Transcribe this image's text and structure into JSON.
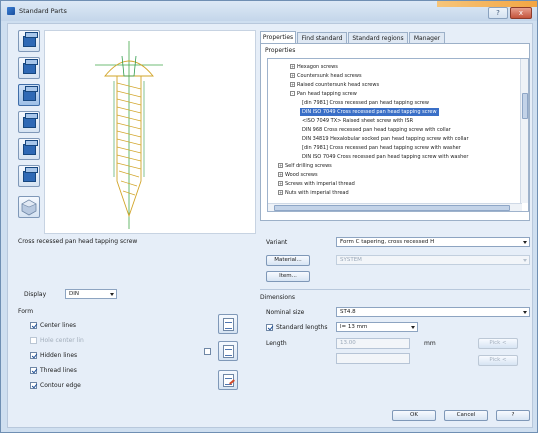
{
  "window": {
    "title": "Standard Parts",
    "help_glyph": "?",
    "close_glyph": "x"
  },
  "preview": {
    "caption": "Cross recessed pan head tapping screw"
  },
  "left": {
    "display_label": "Display",
    "display_value": "DIN",
    "form_label": "Form",
    "checkboxes": [
      {
        "label": "Center lines",
        "checked": true,
        "enabled": true
      },
      {
        "label": "Hole center lin",
        "checked": false,
        "enabled": false
      },
      {
        "label": "Hidden lines",
        "checked": true,
        "enabled": true
      },
      {
        "label": "Thread lines",
        "checked": true,
        "enabled": true
      },
      {
        "label": "Contour edge",
        "checked": true,
        "enabled": true
      }
    ]
  },
  "tabs": [
    "Properties",
    "Find standard",
    "Standard regions",
    "Manager"
  ],
  "properties": {
    "group_label": "Properties",
    "tree": [
      {
        "label": "Hexagon screws",
        "level": 2,
        "expander": "+",
        "selected": false
      },
      {
        "label": "Countersunk head screws",
        "level": 2,
        "expander": "+",
        "selected": false
      },
      {
        "label": "Raised countersunk head screws",
        "level": 2,
        "expander": "+",
        "selected": false
      },
      {
        "label": "Pan head tapping screw",
        "level": 2,
        "expander": "-",
        "selected": false
      },
      {
        "label": "[din 7981]  Cross recessed pan head tapping screw",
        "level": 3,
        "expander": "",
        "selected": false
      },
      {
        "label": "DIN ISO 7049  Cross recessed pan head tapping screw",
        "level": 3,
        "expander": "",
        "selected": true
      },
      {
        "label": "<ISO 7049 TX>  Raised sheet screw with ISR",
        "level": 3,
        "expander": "",
        "selected": false
      },
      {
        "label": "DIN 968  Cross recessed pan head tapping screw with collar",
        "level": 3,
        "expander": "",
        "selected": false
      },
      {
        "label": "DIN 34819  Hexalobular socked pan head tapping screw with collar",
        "level": 3,
        "expander": "",
        "selected": false
      },
      {
        "label": "[din 7981]  Cross recessed pan head tapping screw with washer",
        "level": 3,
        "expander": "",
        "selected": false
      },
      {
        "label": "DIN ISO 7049  Cross recessed pan head tapping screw with washer",
        "level": 3,
        "expander": "",
        "selected": false
      },
      {
        "label": "Self drilling screws",
        "level": 1,
        "expander": "+",
        "selected": false
      },
      {
        "label": "Wood screws",
        "level": 1,
        "expander": "+",
        "selected": false
      },
      {
        "label": "Screws with imperial thread",
        "level": 1,
        "expander": "+",
        "selected": false
      },
      {
        "label": "Nuts with imperial thread",
        "level": 1,
        "expander": "+",
        "selected": false
      }
    ],
    "variant_label": "Variant",
    "variant_value": "Form C tapering, cross recessed H",
    "material_button": "Material...",
    "material_value": "SYSTEM",
    "item_button": "Item..."
  },
  "dimensions": {
    "group_label": "Dimensions",
    "nominal_label": "Nominal size",
    "nominal_value": "ST4.8",
    "standard_lengths_label": "Standard lengths",
    "standard_lengths_checked": true,
    "standard_lengths_value": "l= 13 mm",
    "length_label": "Length",
    "length_value": "13.00",
    "length_unit": "mm",
    "pick_label": "Pick <"
  },
  "footer": {
    "ok": "OK",
    "cancel": "Cancel",
    "help": "?"
  },
  "colors": {
    "selection": "#3a6fc7",
    "screw_outline": "#d2a52a",
    "axis": "#43a84a"
  }
}
